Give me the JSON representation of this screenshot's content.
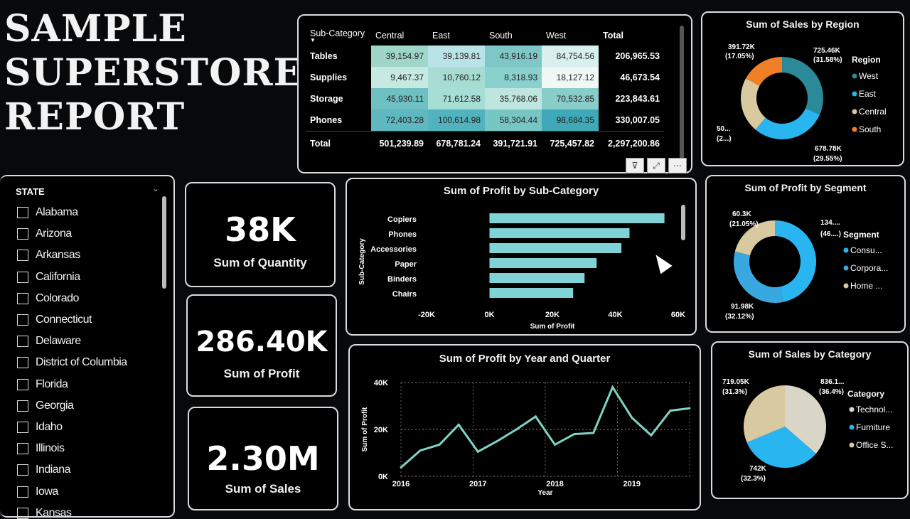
{
  "title": {
    "line1": "SAMPLE",
    "line2": "SUPERSTORE",
    "line3": "REPORT"
  },
  "matrix": {
    "headers": [
      "Sub-Category",
      "Central",
      "East",
      "South",
      "West",
      "Total"
    ],
    "rows": [
      {
        "label": "Tables",
        "values": [
          "39,154.97",
          "39,139.81",
          "43,916.19",
          "84,754.56"
        ],
        "total": "206,965.53"
      },
      {
        "label": "Supplies",
        "values": [
          "9,467.37",
          "10,760.12",
          "8,318.93",
          "18,127.12"
        ],
        "total": "46,673.54"
      },
      {
        "label": "Storage",
        "values": [
          "45,930.11",
          "71,612.58",
          "35,768.06",
          "70,532.85"
        ],
        "total": "223,843.61"
      },
      {
        "label": "Phones",
        "values": [
          "72,403.28",
          "100,614.98",
          "58,304.44",
          "98,684.35"
        ],
        "total": "330,007.05"
      }
    ],
    "total_row": {
      "label": "Total",
      "values": [
        "501,239.89",
        "678,781.24",
        "391,721.91",
        "725,457.82"
      ],
      "total": "2,297,200.86"
    }
  },
  "slicer": {
    "header": "STATE",
    "items": [
      "Alabama",
      "Arizona",
      "Arkansas",
      "California",
      "Colorado",
      "Connecticut",
      "Delaware",
      "District of Columbia",
      "Florida",
      "Georgia",
      "Idaho",
      "Illinois",
      "Indiana",
      "Iowa",
      "Kansas"
    ]
  },
  "kpis": {
    "quantity": {
      "value": "38K",
      "label": "Sum of Quantity"
    },
    "profit": {
      "value": "286.40K",
      "label": "Sum of Profit"
    },
    "sales": {
      "value": "2.30M",
      "label": "Sum of Sales"
    }
  },
  "colors": {
    "west": "#2a8a9a",
    "east": "#29b6f0",
    "central": "#d9c9a0",
    "south": "#f07f27",
    "seg1": "#29b6f0",
    "seg2": "#3aa8e0",
    "seg3": "#d9c9a0",
    "tech": "#d9d6c8",
    "furn": "#29b6f0"
  },
  "profit_by_subcat": {
    "title": "Sum of Profit by Sub-Category",
    "chart_data": {
      "type": "bar",
      "orientation": "horizontal",
      "categories": [
        "Copiers",
        "Phones",
        "Accessories",
        "Paper",
        "Binders",
        "Chairs"
      ],
      "values": [
        55618,
        44516,
        41937,
        34054,
        30222,
        26590
      ],
      "xlim": [
        -20000,
        60000
      ],
      "xticks": [
        "-20K",
        "0K",
        "20K",
        "40K",
        "60K"
      ],
      "xlabel": "Sum of Profit",
      "ylabel": "Sub-Category"
    }
  },
  "profit_by_quarter": {
    "title": "Sum of Profit by Year and Quarter",
    "chart_data": {
      "type": "line",
      "x": [
        "2016 Q1",
        "2016 Q2",
        "2016 Q3",
        "2016 Q4",
        "2017 Q1",
        "2017 Q2",
        "2017 Q3",
        "2017 Q4",
        "2018 Q1",
        "2018 Q2",
        "2018 Q3",
        "2018 Q4",
        "2019 Q1",
        "2019 Q2",
        "2019 Q3",
        "2019 Q4"
      ],
      "values": [
        3800,
        11000,
        13500,
        22000,
        10500,
        15000,
        20000,
        25500,
        13500,
        18000,
        18500,
        38000,
        25000,
        17500,
        28000,
        29000
      ],
      "ylim": [
        0,
        40000
      ],
      "yticks": [
        "0K",
        "20K",
        "40K"
      ],
      "xticks": [
        "2016",
        "2017",
        "2018",
        "2019"
      ],
      "xlabel": "Year",
      "ylabel": "Sum of Profit"
    }
  },
  "sales_by_region": {
    "title": "Sum of Sales by Region",
    "legend_title": "Region",
    "chart_data": {
      "type": "pie",
      "labels": [
        "West",
        "East",
        "Central",
        "South"
      ],
      "values": [
        725.46,
        678.78,
        501.24,
        391.72
      ],
      "data_labels": [
        "725.46K (31.58%)",
        "678.78K (29.55%)",
        "50... (2...)",
        "391.72K (17.05%)"
      ]
    },
    "labels": {
      "a": "391.72K",
      "a2": "(17.05%)",
      "b": "725.46K",
      "b2": "(31.58%)",
      "c": "678.78K",
      "c2": "(29.55%)",
      "d": "50...",
      "d2": "(2...)"
    }
  },
  "profit_by_segment": {
    "title": "Sum of Profit by Segment",
    "legend_title": "Segment",
    "chart_data": {
      "type": "pie",
      "labels": [
        "Consu...",
        "Corpora...",
        "Home ..."
      ],
      "values": [
        134.1,
        91.98,
        60.3
      ]
    },
    "labels": {
      "a": "60.3K",
      "a2": "(21.05%)",
      "b": "134....",
      "b2": "(46....)",
      "c": "91.98K",
      "c2": "(32.12%)"
    }
  },
  "sales_by_category": {
    "title": "Sum of Sales by Category",
    "legend_title": "Category",
    "chart_data": {
      "type": "pie",
      "labels": [
        "Technol...",
        "Furniture",
        "Office S..."
      ],
      "values": [
        836.1,
        742,
        719.05
      ]
    },
    "labels": {
      "a": "719.05K",
      "a2": "(31.3%)",
      "b": "836.1...",
      "b2": "(36.4%)",
      "c": "742K",
      "c2": "(32.3%)"
    }
  }
}
